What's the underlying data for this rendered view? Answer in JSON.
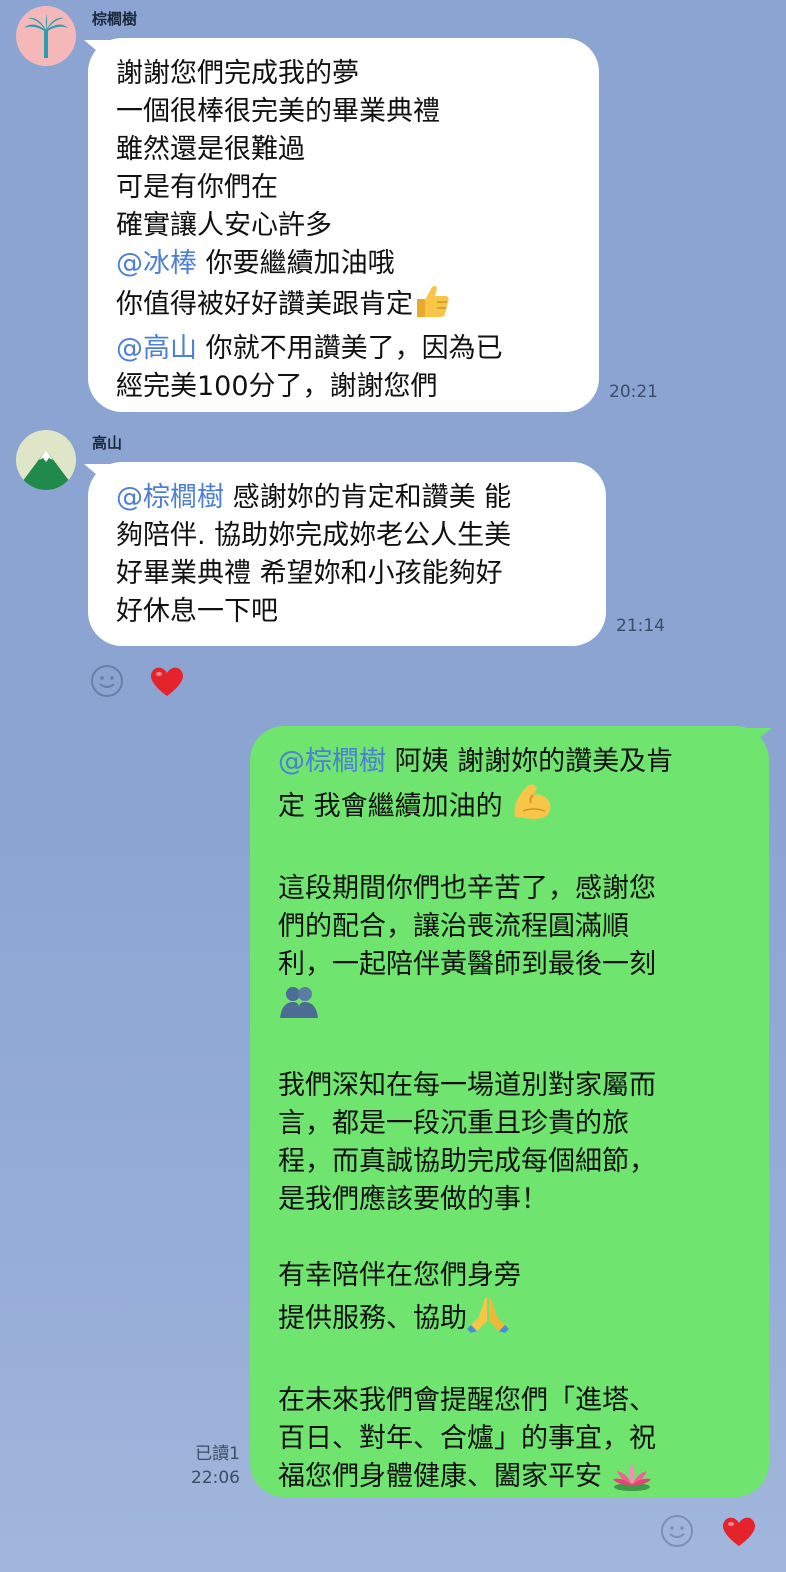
{
  "background_color": "#8ba4d2",
  "messages": [
    {
      "sender": "棕櫚樹",
      "time": "20:21",
      "lines": [
        {
          "text": "謝謝您們完成我的夢"
        },
        {
          "text": "一個很棒很完美的畢業典禮"
        },
        {
          "text": "雖然還是很難過"
        },
        {
          "text": "可是有你們在"
        },
        {
          "text": "確實讓人安心許多"
        },
        {
          "mention": "@冰棒",
          "text": " 你要繼續加油哦"
        },
        {
          "text": "你值得被好好讚美跟肯定",
          "emoji": "thumbs-up-icon"
        },
        {
          "mention": "@高山",
          "text": " 你就不用讚美了，因為已"
        },
        {
          "text": "經完美100分了，謝謝您們"
        }
      ]
    },
    {
      "sender": "高山",
      "time": "21:14",
      "lines": [
        {
          "mention": "@棕櫚樹",
          "text": " 感謝妳的肯定和讚美 能"
        },
        {
          "text": "夠陪伴. 協助妳完成妳老公人生美"
        },
        {
          "text": "好畢業典禮 希望妳和小孩能夠好"
        },
        {
          "text": "好休息一下吧"
        }
      ]
    },
    {
      "sender": "",
      "time": "22:06",
      "read_status": "已讀1",
      "lines": [
        {
          "mention": "@棕櫚樹",
          "text": " 阿姨 謝謝妳的讚美及肯"
        },
        {
          "text": "定 我會繼續加油的 ",
          "emoji": "flexed-biceps-icon"
        },
        {
          "gap": true
        },
        {
          "text": "這段期間你們也辛苦了，感謝您"
        },
        {
          "text": "們的配合，讓治喪流程圓滿順"
        },
        {
          "text": "利，一起陪伴黃醫師到最後一刻"
        },
        {
          "emoji": "hugging-people-icon"
        },
        {
          "gap": true
        },
        {
          "text": "我們深知在每一場道別對家屬而"
        },
        {
          "text": "言，都是一段沉重且珍貴的旅"
        },
        {
          "text": "程，而真誠協助完成每個細節，"
        },
        {
          "text": "是我們應該要做的事！"
        },
        {
          "gap": true
        },
        {
          "text": "有幸陪伴在您們身旁"
        },
        {
          "text": "提供服務、協助",
          "emoji": "folded-hands-icon"
        },
        {
          "gap": true
        },
        {
          "text": "在未來我們會提醒您們「進塔、"
        },
        {
          "text": "百日、對年、合爐」的事宜，祝"
        },
        {
          "text": "福您們身體健康、闔家平安 ",
          "emoji": "lotus-icon"
        }
      ]
    }
  ]
}
